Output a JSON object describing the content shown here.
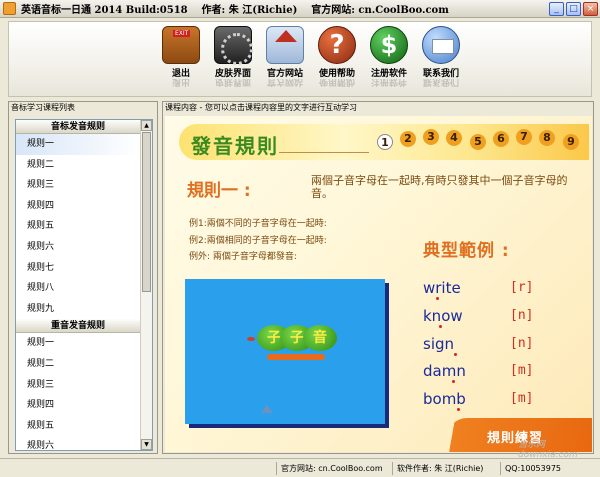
{
  "window": {
    "title": "英语音标一日通 2014 Build:0518    作者: 朱 江(Richie)    官方网站: cn.CoolBoo.com",
    "minimize": "_",
    "maximize": "□",
    "close": "×"
  },
  "toolbar": {
    "exit": "退出",
    "skin": "皮肤界面",
    "website": "官方网站",
    "help": "使用帮助",
    "register": "注册软件",
    "contact": "联系我们",
    "help_glyph": "?",
    "register_glyph": "$"
  },
  "left_panel": {
    "title": "音标学习课程列表",
    "groups": [
      {
        "header": "音标发音规则",
        "items": [
          "规则一",
          "规则二",
          "规则三",
          "规则四",
          "规则五",
          "规则六",
          "规则七",
          "规则八",
          "规则九"
        ]
      },
      {
        "header": "重音发音规则",
        "items": [
          "规则一",
          "规则二",
          "规则三",
          "规则四",
          "规则五",
          "规则六"
        ]
      }
    ],
    "selected": "规则一"
  },
  "right_panel": {
    "title": "课程内容 - 您可以点击课程内容里的文字进行互动学习",
    "lesson_title": "發音規則",
    "numbers": [
      "1",
      "2",
      "3",
      "4",
      "5",
      "6",
      "7",
      "8",
      "9"
    ],
    "current_number": "1",
    "rule_heading": "規則一 :",
    "rule_description": "兩個子音字母在一起時,有時只發其中一個子音字母的音。",
    "examples": [
      "例1:兩個不同的子音字母在一起時:",
      "例2:兩個相同的子音字母在一起時:",
      "例外: 兩個子音字母都發音:"
    ],
    "typical_heading": "典型範例 :",
    "animation_text": [
      "子",
      "子",
      "音"
    ],
    "words": [
      {
        "word": "write",
        "ipa": "[r]"
      },
      {
        "word": "know",
        "ipa": "[n]"
      },
      {
        "word": "sign",
        "ipa": "[n]"
      },
      {
        "word": "damn",
        "ipa": "[m]"
      },
      {
        "word": "bomb",
        "ipa": "[m]"
      }
    ],
    "practice_button": "規則練習"
  },
  "statusbar": {
    "website": "官方网站: cn.CoolBoo.com",
    "author": "软件作者: 朱 江(Richie)",
    "qq": "QQ:10053975"
  },
  "watermark": "当乐网 downxia.com"
}
